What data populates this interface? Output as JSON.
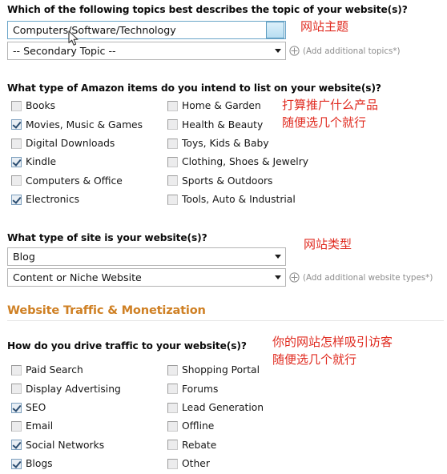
{
  "colors": {
    "section_header": "#cf8024",
    "annotation_red": "#e02b20",
    "focus_blue": "#6aa5c8",
    "muted_gray": "#8d8d8d"
  },
  "topic_question": {
    "label": "Which of the following topics best describes the topic of your website(s)?",
    "primary_select": {
      "value": "Computers/Software/Technology",
      "focused": true
    },
    "secondary_select": {
      "value": "-- Secondary Topic --"
    },
    "add_more": {
      "icon": "circle-plus-icon",
      "text": "(Add additional topics*)"
    },
    "annotation": "网站主题"
  },
  "items_question": {
    "label": "What type of Amazon items do you intend to list on your website(s)?",
    "annotation_line1": "打算推广什么产品",
    "annotation_line2": "随便选几个就行",
    "left_column": [
      {
        "label": "Books",
        "checked": false
      },
      {
        "label": "Movies, Music & Games",
        "checked": true
      },
      {
        "label": "Digital Downloads",
        "checked": false
      },
      {
        "label": "Kindle",
        "checked": true
      },
      {
        "label": "Computers & Office",
        "checked": false
      },
      {
        "label": "Electronics",
        "checked": true
      }
    ],
    "right_column": [
      {
        "label": "Home & Garden",
        "checked": false
      },
      {
        "label": "Health & Beauty",
        "checked": false
      },
      {
        "label": "Toys, Kids & Baby",
        "checked": false
      },
      {
        "label": "Clothing, Shoes & Jewelry",
        "checked": false
      },
      {
        "label": "Sports & Outdoors",
        "checked": false
      },
      {
        "label": "Tools, Auto & Industrial",
        "checked": false
      }
    ]
  },
  "sitetype_question": {
    "label": "What type of site is your website(s)?",
    "primary_select": {
      "value": "Blog"
    },
    "secondary_select": {
      "value": "Content or Niche Website"
    },
    "add_more": {
      "icon": "circle-plus-icon",
      "text": "(Add additional website types*)"
    },
    "annotation": "网站类型"
  },
  "traffic_section": {
    "header": "Website Traffic & Monetization",
    "question_label": "How do you drive traffic to your website(s)?",
    "annotation_line1": "你的网站怎样吸引访客",
    "annotation_line2": "随便选几个就行",
    "left_column": [
      {
        "label": "Paid Search",
        "checked": false
      },
      {
        "label": "Display Advertising",
        "checked": false
      },
      {
        "label": "SEO",
        "checked": true
      },
      {
        "label": "Email",
        "checked": false
      },
      {
        "label": "Social Networks",
        "checked": true
      },
      {
        "label": "Blogs",
        "checked": true
      }
    ],
    "right_column": [
      {
        "label": "Shopping Portal",
        "checked": false
      },
      {
        "label": "Forums",
        "checked": false
      },
      {
        "label": "Lead Generation",
        "checked": false
      },
      {
        "label": "Offline",
        "checked": false
      },
      {
        "label": "Rebate",
        "checked": false
      },
      {
        "label": "Other",
        "checked": false
      }
    ]
  }
}
